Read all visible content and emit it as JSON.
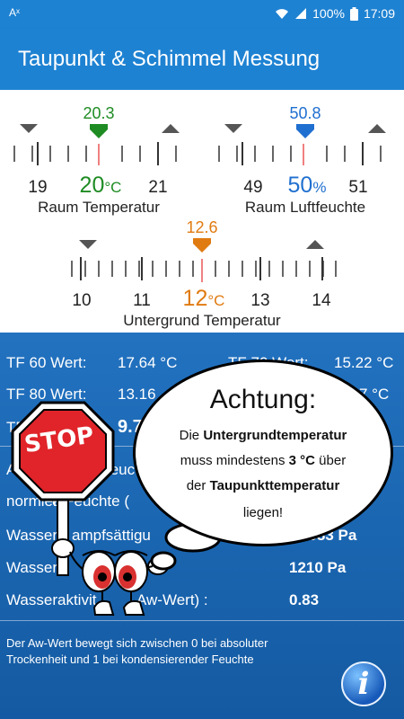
{
  "status": {
    "left_icon": "Aˣ",
    "battery": "100%",
    "time": "17:09"
  },
  "appbar": {
    "title": "Taupunkt & Schimmel Messung"
  },
  "sliders": {
    "temp": {
      "marker": "20.3",
      "low": "19",
      "value": "20",
      "unit": "°C",
      "high": "21",
      "caption": "Raum Temperatur",
      "color": "#1e8c23"
    },
    "humidity": {
      "marker": "50.8",
      "low": "49",
      "value": "50",
      "unit": "%",
      "high": "51",
      "caption": "Raum Luftfeuchte",
      "color": "#1f6fd0"
    },
    "surface": {
      "marker": "12.6",
      "t1": "10",
      "t2": "11",
      "value": "12",
      "unit": "°C",
      "t3": "13",
      "t4": "14",
      "caption": "Untergrund Temperatur",
      "color": "#e07b12"
    }
  },
  "results": {
    "tf60_label": "TF 60 Wert:",
    "tf60_value": "17.64 °C",
    "tf70_label": "TF 70 Wert:",
    "tf70_value": "15.22 °C",
    "tf80_label": "TF 80 Wert:",
    "tf80_value": "13.16",
    "tf80b_value": "7 °C",
    "tf_short": "TF",
    "tf_short_val": "9.7",
    "abs_label": "A",
    "abs_tail": "feuc",
    "norm_label": "normier",
    "norm_tail": "e Feuchte (",
    "sat_label": "Wasserd",
    "sat_tail": "ampfsättigu",
    "sat_value": "2083 Pa",
    "vap_label": "Wassere",
    "vap_value": "1210 Pa",
    "aw_label": "Wasseraktivit",
    "aw_tail": "Aw-Wert) :",
    "aw_value": "0.83",
    "footnote": "Der Aw-Wert bewegt sich zwischen 0 bei absoluter Trockenheit und 1 bei kondensierender Feuchte",
    "info_glyph": "i"
  },
  "warning": {
    "title": "Achtung:",
    "l1a": "Die ",
    "l1b": "Untergrundtemperatur",
    "l2a": "muss mindestens ",
    "l2b": "3 °C",
    "l2c": " über",
    "l3a": "der ",
    "l3b": "Taupunkttemperatur",
    "l4": "liegen!",
    "sign": "STOP"
  }
}
